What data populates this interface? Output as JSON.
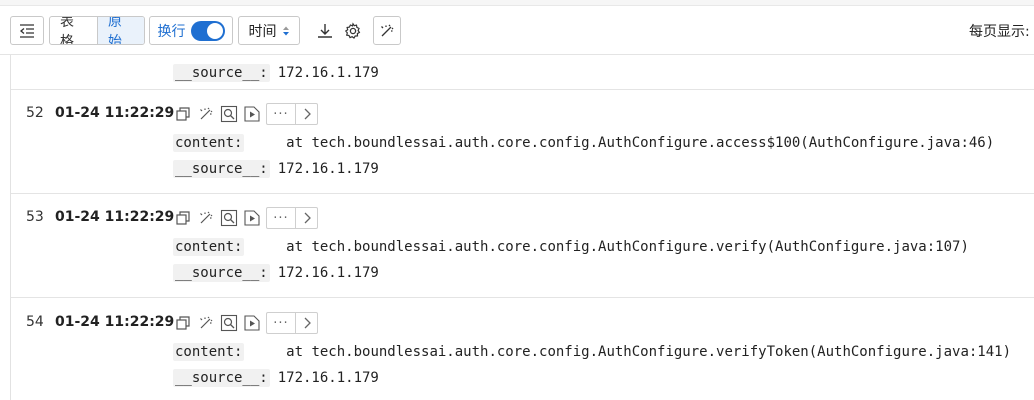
{
  "toolbar": {
    "table_label": "表格",
    "raw_label": "原始",
    "wrap_label": "换行",
    "wrap_on": true,
    "time_label": "时间",
    "per_page_label": "每页显示:"
  },
  "logs": {
    "partial": {
      "source_key": "__source__:",
      "source_value": "172.16.1.179"
    },
    "entries": [
      {
        "num": "52",
        "time": "01-24 11:22:29",
        "content_key": "content:",
        "content_value": "    at tech.boundlessai.auth.core.config.AuthConfigure.access$100(AuthConfigure.java:46)",
        "source_key": "__source__:",
        "source_value": "172.16.1.179"
      },
      {
        "num": "53",
        "time": "01-24 11:22:29",
        "content_key": "content:",
        "content_value": "    at tech.boundlessai.auth.core.config.AuthConfigure.verify(AuthConfigure.java:107)",
        "source_key": "__source__:",
        "source_value": "172.16.1.179"
      },
      {
        "num": "54",
        "time": "01-24 11:22:29",
        "content_key": "content:",
        "content_value": "    at tech.boundlessai.auth.core.config.AuthConfigure.verifyToken(AuthConfigure.java:141)",
        "source_key": "__source__:",
        "source_value": "172.16.1.179"
      }
    ]
  },
  "icons": {
    "collapse": "indent-collapse-icon",
    "download": "download-icon",
    "settings": "gear-icon",
    "magic": "magic-wand-icon",
    "copy": "copy-icon",
    "search": "search-context-icon",
    "play": "play-icon",
    "more": "more-icon",
    "next": "chevron-right-icon",
    "sort": "sort-icon"
  },
  "colors": {
    "accent": "#1f6fd1",
    "border": "#c9c9c9",
    "key_bg": "#f1f1f1"
  }
}
